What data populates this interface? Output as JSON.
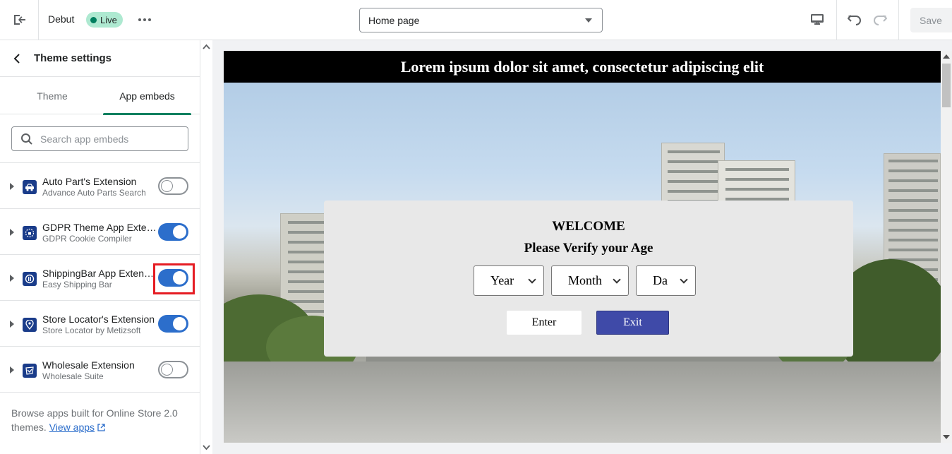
{
  "topbar": {
    "theme_name": "Debut",
    "live_badge": "Live",
    "page_select": "Home page",
    "save_label": "Save"
  },
  "sidebar": {
    "title": "Theme settings",
    "tabs": [
      {
        "label": "Theme",
        "active": false
      },
      {
        "label": "App embeds",
        "active": true
      }
    ],
    "search_placeholder": "Search app embeds",
    "embeds": [
      {
        "name": "Auto Part's Extension",
        "subtitle": "Advance Auto Parts Search",
        "enabled": false
      },
      {
        "name": "GDPR Theme App Extension",
        "subtitle": "GDPR Cookie Compiler",
        "enabled": true
      },
      {
        "name": "ShippingBar App Extension",
        "subtitle": "Easy Shipping Bar",
        "enabled": true,
        "highlighted": true
      },
      {
        "name": "Store Locator's Extension",
        "subtitle": "Store Locator by Metizsoft",
        "enabled": true
      },
      {
        "name": "Wholesale Extension",
        "subtitle": "Wholesale Suite",
        "enabled": false
      }
    ],
    "footer_text": "Browse apps built for Online Store 2.0 themes.",
    "footer_link": "View apps"
  },
  "preview": {
    "banner_text": "Lorem ipsum dolor sit amet, consectetur adipiscing elit",
    "modal": {
      "welcome": "WELCOME",
      "verify": "Please Verify your Age",
      "year": "Year",
      "month": "Month",
      "day": "Da",
      "enter_label": "Enter",
      "exit_label": "Exit"
    }
  },
  "colors": {
    "accent": "#2c6ecb",
    "tab_underline": "#008060",
    "live_badge": "#aee9d1",
    "highlight": "#e51c23",
    "exit_button": "#3f4aa8"
  }
}
